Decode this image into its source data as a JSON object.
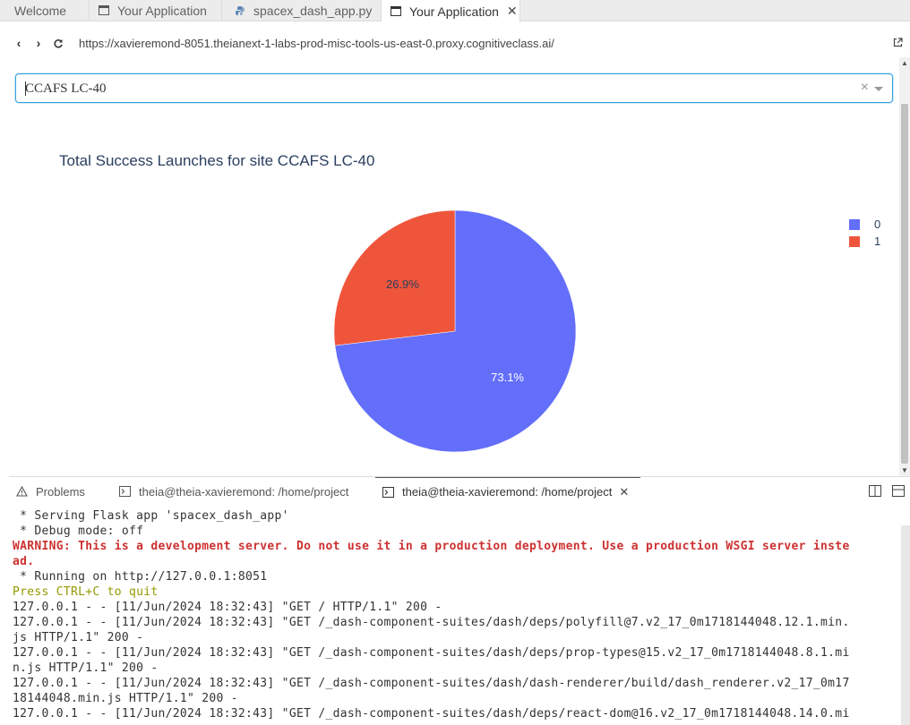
{
  "editor_tabs": [
    {
      "label": "Welcome",
      "icon": "none"
    },
    {
      "label": "Your Application",
      "icon": "window-icon"
    },
    {
      "label": "spacex_dash_app.py",
      "icon": "python-icon"
    },
    {
      "label": "Your Application",
      "icon": "window-icon",
      "active": true
    }
  ],
  "browser": {
    "url": "https://xavieremond-8051.theianext-1-labs-prod-misc-tools-us-east-0.proxy.cognitiveclass.ai/"
  },
  "dropdown": {
    "value": "CCAFS LC-40",
    "clear_glyph": "×"
  },
  "chart_data": {
    "type": "pie",
    "title": "Total Success Launches for site CCAFS LC-40",
    "categories": [
      "0",
      "1"
    ],
    "values": [
      73.1,
      26.9
    ],
    "labels": [
      "73.1%",
      "26.9%"
    ],
    "colors": [
      "#636efa",
      "#ef553b"
    ],
    "legend_position": "top-right"
  },
  "panel": {
    "tabs": [
      {
        "label": "Problems",
        "icon": "warning-icon"
      },
      {
        "label": "theia@theia-xavieremond: /home/project",
        "icon": "terminal-icon"
      },
      {
        "label": "theia@theia-xavieremond: /home/project",
        "icon": "terminal-icon",
        "active": true
      }
    ]
  },
  "terminal": {
    "lines": [
      {
        "text": " * Serving Flask app 'spacex_dash_app'",
        "style": "normal"
      },
      {
        "text": " * Debug mode: off",
        "style": "normal"
      },
      {
        "text": "WARNING: This is a development server. Do not use it in a production deployment. Use a production WSGI server inste",
        "style": "warn"
      },
      {
        "text": "ad.",
        "style": "warn"
      },
      {
        "text": " * Running on http://127.0.0.1:8051",
        "style": "normal"
      },
      {
        "text": "Press CTRL+C to quit",
        "style": "yellow"
      },
      {
        "text": "127.0.0.1 - - [11/Jun/2024 18:32:43] \"GET / HTTP/1.1\" 200 -",
        "style": "normal"
      },
      {
        "text": "127.0.0.1 - - [11/Jun/2024 18:32:43] \"GET /_dash-component-suites/dash/deps/polyfill@7.v2_17_0m1718144048.12.1.min.",
        "style": "normal"
      },
      {
        "text": "js HTTP/1.1\" 200 -",
        "style": "normal"
      },
      {
        "text": "127.0.0.1 - - [11/Jun/2024 18:32:43] \"GET /_dash-component-suites/dash/deps/prop-types@15.v2_17_0m1718144048.8.1.mi",
        "style": "normal"
      },
      {
        "text": "n.js HTTP/1.1\" 200 -",
        "style": "normal"
      },
      {
        "text": "127.0.0.1 - - [11/Jun/2024 18:32:43] \"GET /_dash-component-suites/dash/dash-renderer/build/dash_renderer.v2_17_0m17",
        "style": "normal"
      },
      {
        "text": "18144048.min.js HTTP/1.1\" 200 -",
        "style": "normal"
      },
      {
        "text": "127.0.0.1 - - [11/Jun/2024 18:32:43] \"GET /_dash-component-suites/dash/deps/react-dom@16.v2_17_0m1718144048.14.0.mi",
        "style": "normal"
      }
    ]
  }
}
